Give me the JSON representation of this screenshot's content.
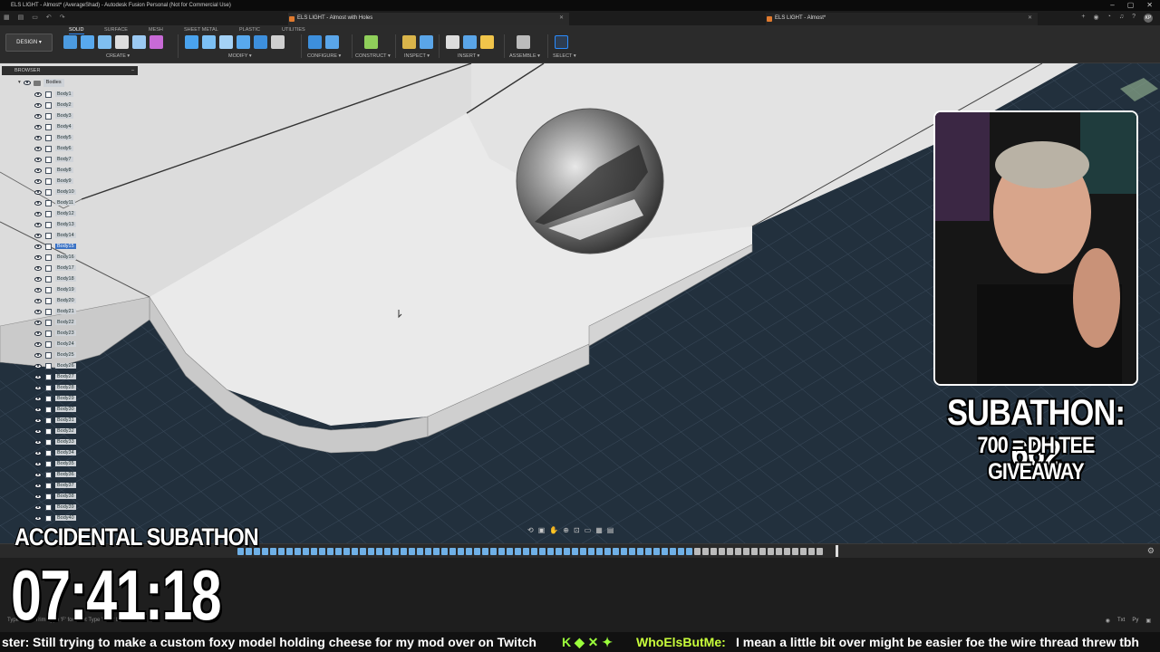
{
  "window": {
    "title": "ELS LIGHT - Almost* (AverageShad) - Autodesk Fusion Personal (Not for Commercial Use)",
    "controls": [
      "–",
      "▢",
      "✕"
    ]
  },
  "tabs": [
    {
      "label": "ELS LIGHT - Almost with Holes",
      "close": "✕"
    },
    {
      "label": "ELS LIGHT - Almost*",
      "close": "✕"
    }
  ],
  "user_initials": "KP",
  "toolbar": {
    "mode": "DESIGN ▾",
    "workspace_tabs": [
      "SOLID",
      "SURFACE",
      "MESH",
      "SHEET METAL",
      "PLASTIC",
      "UTILITIES"
    ],
    "groups": [
      "CREATE ▾",
      "MODIFY ▾",
      "CONFIGURE ▾",
      "CONSTRUCT ▾",
      "INSPECT ▾",
      "INSERT ▾",
      "ASSEMBLE ▾",
      "SELECT ▾"
    ]
  },
  "browser": {
    "header": "BROWSER",
    "folder": "Bodies",
    "bodies": [
      "Body1",
      "Body2",
      "Body3",
      "Body4",
      "Body5",
      "Body6",
      "Body7",
      "Body8",
      "Body9",
      "Body10",
      "Body11",
      "Body12",
      "Body13",
      "Body14",
      "Body15",
      "Body16",
      "Body17",
      "Body18",
      "Body19",
      "Body20",
      "Body21",
      "Body22",
      "Body23",
      "Body24",
      "Body25",
      "Body26",
      "Body27",
      "Body28",
      "Body29",
      "Body30",
      "Body31",
      "Body32",
      "Body33",
      "Body34",
      "Body35",
      "Body36",
      "Body37",
      "Body38",
      "Body39",
      "Body40"
    ],
    "selected": [
      "Body15"
    ]
  },
  "status": {
    "left": "Type 'T' for Trim  Type 'F' for Fillet  Type 'L' for Line",
    "right": [
      "Txt",
      "Py"
    ]
  },
  "overlay": {
    "subathon_label": "ACCIDENTAL SUBATHON",
    "timer": "07:41:18",
    "sub_count": "SUBATHON: 662",
    "goal": "700 = DH TEE GIVEAWAY"
  },
  "chat": {
    "lead_user": "ster:",
    "message1": "Still trying to make a custom foxy model holding cheese for my mod over on Twitch",
    "user2": "WhoElsButMe:",
    "message2": "I mean a little bit over might be easier foe the wire thread threw tbh"
  },
  "colors": {
    "accent": "#2a8cff",
    "selection": "#3a72c4",
    "chat_user": "#c9ff3b"
  }
}
